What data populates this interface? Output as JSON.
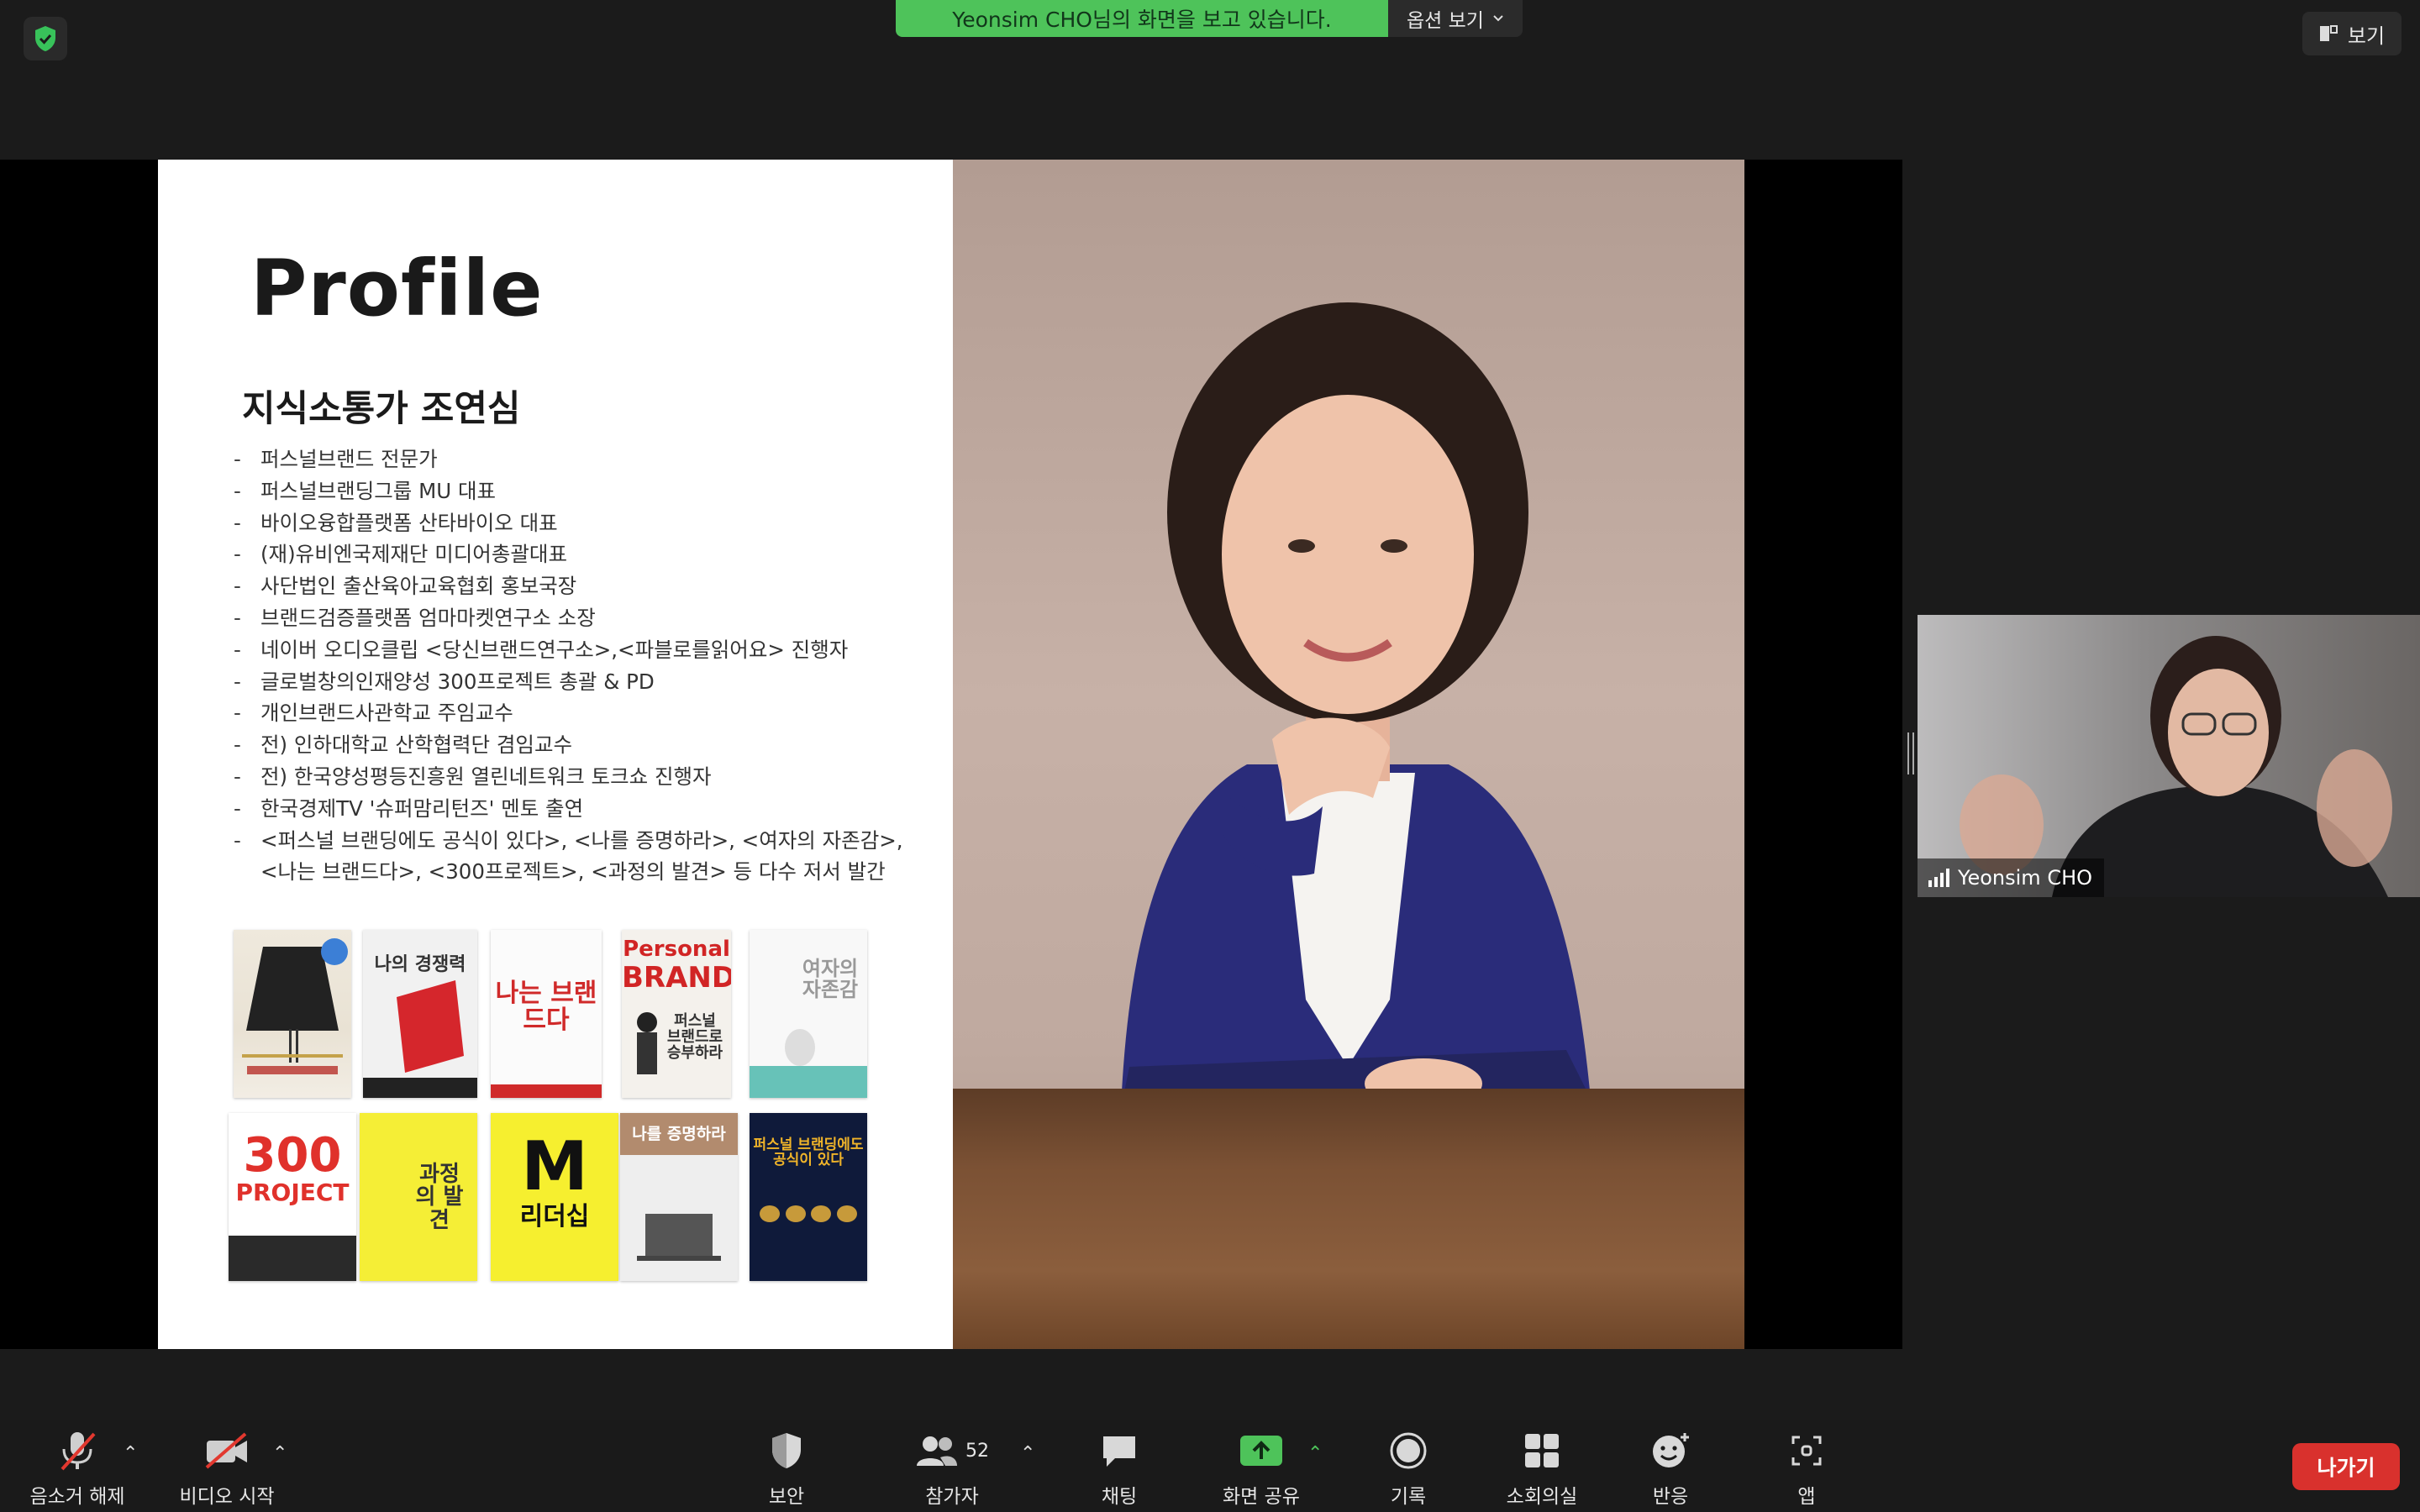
{
  "top": {
    "banner_text": "Yeonsim CHO님의 화면을 보고 있습니다.",
    "options_label": "옵션 보기",
    "view_label": "보기"
  },
  "slide": {
    "title": "Profile",
    "name": "지식소통가 조연심",
    "bio": [
      "퍼스널브랜드 전문가",
      "퍼스널브랜딩그룹 MU 대표",
      "바이오융합플랫폼 산타바이오 대표",
      "(재)유비엔국제재단 미디어총괄대표",
      "사단법인 출산육아교육협회 홍보국장",
      "브랜드검증플랫폼 엄마마켓연구소 소장",
      "네이버 오디오클립 <당신브랜드연구소>,<파블로를읽어요> 진행자",
      "글로벌창의인재양성 300프로젝트 총괄 & PD",
      "개인브랜드사관학교 주임교수",
      "전) 인하대학교 산학협력단 겸임교수",
      "전) 한국양성평등진흥원 열린네트워크 토크쇼 진행자",
      "한국경제TV '슈퍼맘리턴즈' 멘토 출연",
      "<퍼스널 브랜딩에도 공식이 있다>, <나를 증명하라>, <여자의 자존감>, <나는 브랜드다>, <300프로젝트>, <과정의 발견> 등 다수 저서 발간"
    ],
    "books": {
      "b2": "나의 경쟁력",
      "b3": "나는 브랜드다",
      "b4_a": "Personal",
      "b4_b": "BRAND",
      "b4_c": "퍼스널 브랜드로 승부하라",
      "b5": "여자의 자존감",
      "b6_a": "300",
      "b6_b": "PROJECT",
      "b7": "과정의 발견",
      "b8_a": "M",
      "b8_b": "리더십",
      "b9": "나를 증명하라",
      "b10": "퍼스널 브랜딩에도 공식이 있다"
    }
  },
  "participant": {
    "name": "Yeonsim CHO"
  },
  "toolbar": {
    "unmute": "음소거 해제",
    "start_video": "비디오 시작",
    "security": "보안",
    "participants": "참가자",
    "participants_count": "52",
    "chat": "채팅",
    "share_screen": "화면 공유",
    "record": "기록",
    "breakout": "소회의실",
    "reactions": "반응",
    "apps": "앱",
    "leave": "나가기"
  },
  "colors": {
    "share_green": "#4ec35a",
    "leave_red": "#d9312d",
    "toolbar_bg": "#1a1a1a"
  }
}
